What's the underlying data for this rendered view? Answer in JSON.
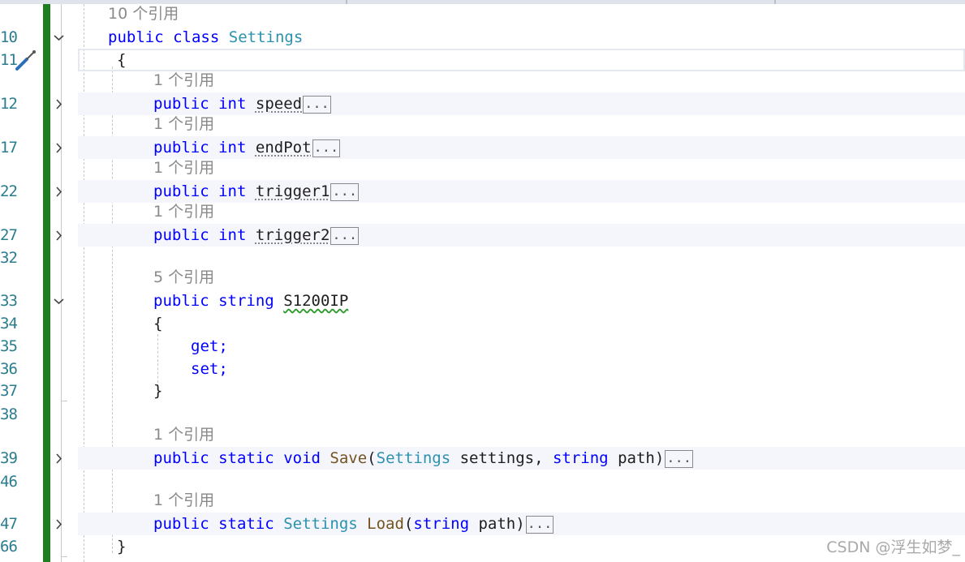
{
  "colors": {
    "keyword": "#0000ff",
    "type": "#2b91af",
    "method": "#74531f",
    "line_number": "#2b7c8f",
    "reference_hint": "#8a8a8a",
    "change_bar": "#1f7f1f"
  },
  "icons": {
    "quick_action": "screwdriver-icon",
    "fold_expanded": "chevron-down-icon",
    "fold_collapsed": "chevron-right-icon"
  },
  "line_numbers": [
    "10",
    "11",
    "12",
    "17",
    "22",
    "27",
    "32",
    "33",
    "34",
    "35",
    "36",
    "37",
    "38",
    "39",
    "46",
    "47",
    "66"
  ],
  "refs": {
    "class": "10 个引用",
    "speed": "1 个引用",
    "endpot": "1 个引用",
    "trigger1": "1 个引用",
    "trigger2": "1 个引用",
    "s1200ip": "5 个引用",
    "save": "1 个引用",
    "load": "1 个引用"
  },
  "tokens": {
    "public": "public",
    "class": "class",
    "int": "int",
    "string": "string",
    "static": "static",
    "void": "void",
    "get": "get;",
    "set": "set;",
    "open_brace": "{",
    "close_brace": "}",
    "settings_type": "Settings",
    "speed": "speed",
    "endpot": "endPot",
    "trigger1": "trigger1",
    "trigger2": "trigger2",
    "s1200ip": "S1200IP",
    "save": "Save",
    "load": "Load",
    "paren_open": "(",
    "paren_close": ")",
    "settings_param": " settings, ",
    "path_param": " path",
    "collapsed": "..."
  },
  "watermark": "CSDN @浮生如梦_"
}
